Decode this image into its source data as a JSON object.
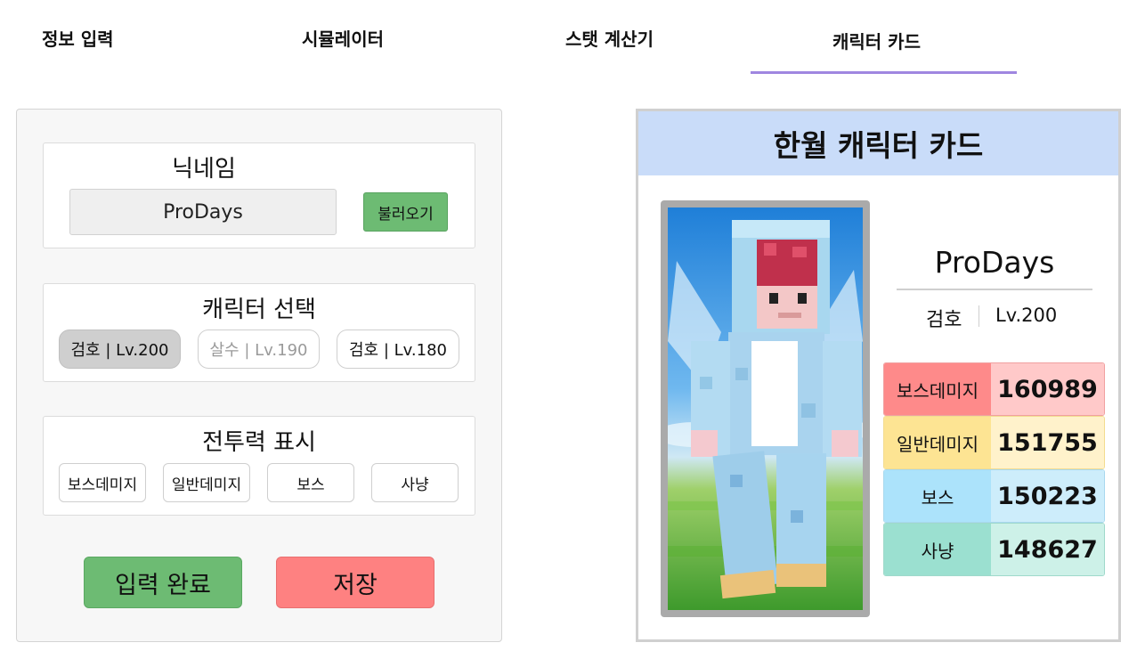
{
  "tabs": [
    {
      "label": "정보 입력"
    },
    {
      "label": "시뮬레이터"
    },
    {
      "label": "스탯 계산기"
    },
    {
      "label": "캐릭터 카드"
    }
  ],
  "active_tab": "캐릭터 카드",
  "form": {
    "nickname": {
      "title": "닉네임",
      "value": "ProDays",
      "load_label": "불러오기"
    },
    "character_select": {
      "title": "캐릭터 선택",
      "options": [
        {
          "label": "검호 | Lv.200",
          "state": "selected"
        },
        {
          "label": "살수 | Lv.190",
          "state": "dimmed"
        },
        {
          "label": "검호 | Lv.180",
          "state": "normal"
        }
      ]
    },
    "combat_power": {
      "title": "전투력 표시",
      "options": [
        {
          "label": "보스데미지"
        },
        {
          "label": "일반데미지"
        },
        {
          "label": "보스"
        },
        {
          "label": "사냥"
        }
      ]
    },
    "done_label": "입력 완료",
    "save_label": "저장"
  },
  "card": {
    "title": "한월 캐릭터 카드",
    "name": "ProDays",
    "class": "검호",
    "level": "Lv.200",
    "stats": [
      {
        "label": "보스데미지",
        "value": "160989",
        "label_color": "#fe8a8a",
        "value_color": "#ffc9c9",
        "border": "#f0a0a0"
      },
      {
        "label": "일반데미지",
        "value": "151755",
        "label_color": "#fde493",
        "value_color": "#fff2cb",
        "border": "#f3dc90"
      },
      {
        "label": "보스",
        "value": "150223",
        "label_color": "#ace3fb",
        "value_color": "#cdedfb",
        "border": "#a8d8ee"
      },
      {
        "label": "사냥",
        "value": "148627",
        "label_color": "#9be0d0",
        "value_color": "#cdf1e8",
        "border": "#9fd9cb"
      }
    ]
  },
  "colors": {
    "accent": "#9f86e0",
    "green_button": "#6dbb73",
    "red_button": "#fe8181",
    "card_header": "#c9dcf9"
  }
}
